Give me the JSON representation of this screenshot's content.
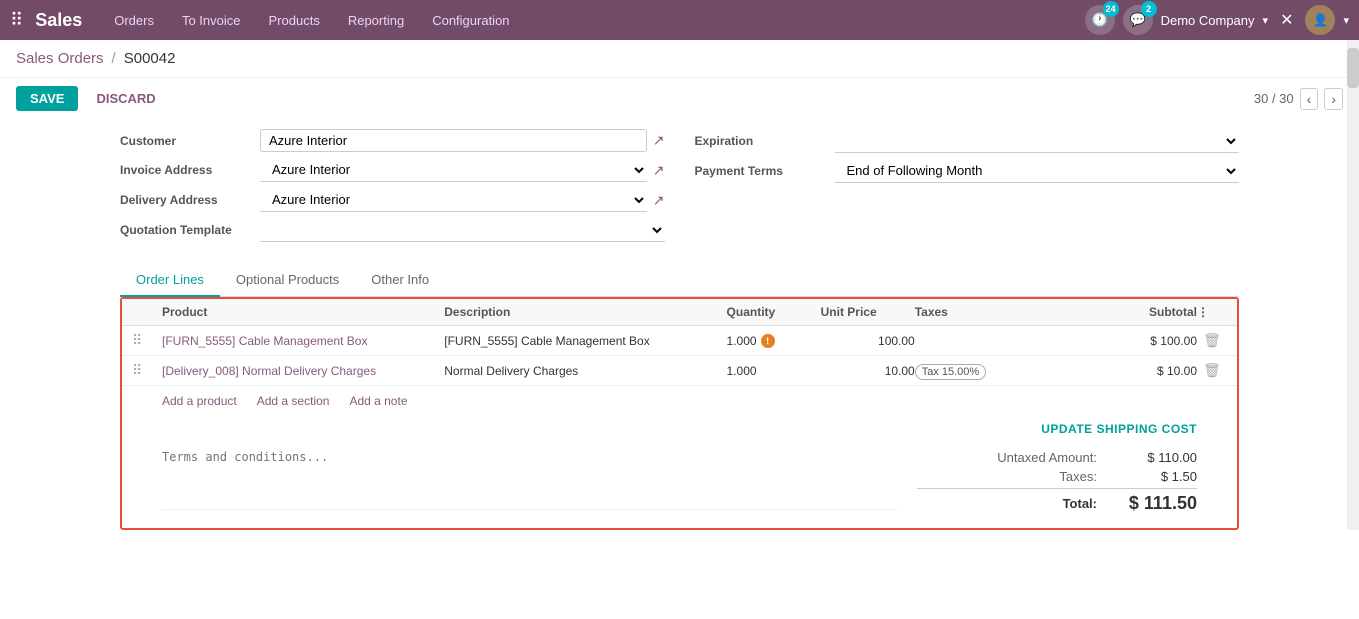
{
  "topnav": {
    "app_name": "Sales",
    "links": [
      "Orders",
      "To Invoice",
      "Products",
      "Reporting",
      "Configuration"
    ],
    "badge_24": "24",
    "badge_2": "2",
    "company": "Demo Company"
  },
  "breadcrumb": {
    "parent": "Sales Orders",
    "separator": "/",
    "current": "S00042"
  },
  "toolbar": {
    "save_label": "SAVE",
    "discard_label": "DISCARD",
    "pagination": "30 / 30"
  },
  "form": {
    "customer_label": "Customer",
    "customer_value": "Azure Interior",
    "invoice_address_label": "Invoice Address",
    "invoice_address_value": "Azure Interior",
    "delivery_address_label": "Delivery Address",
    "delivery_address_value": "Azure Interior",
    "quotation_template_label": "Quotation Template",
    "quotation_template_value": "",
    "expiration_label": "Expiration",
    "expiration_value": "",
    "payment_terms_label": "Payment Terms",
    "payment_terms_value": "End of Following Month"
  },
  "tabs": [
    {
      "label": "Order Lines",
      "active": true
    },
    {
      "label": "Optional Products",
      "active": false
    },
    {
      "label": "Other Info",
      "active": false
    }
  ],
  "table": {
    "headers": [
      "",
      "Product",
      "Description",
      "Quantity",
      "Unit Price",
      "Taxes",
      "Subtotal",
      ""
    ],
    "rows": [
      {
        "product": "[FURN_5555] Cable Management Box",
        "description": "[FURN_5555] Cable Management Box",
        "quantity": "1.000",
        "unit_price": "100.00",
        "taxes": "",
        "subtotal": "$ 100.00",
        "has_info": true
      },
      {
        "product": "[Delivery_008] Normal Delivery Charges",
        "description": "Normal Delivery Charges",
        "quantity": "1.000",
        "unit_price": "10.00",
        "taxes": "Tax 15.00%",
        "subtotal": "$ 10.00",
        "has_info": false
      }
    ],
    "add_product": "Add a product",
    "add_section": "Add a section",
    "add_note": "Add a note"
  },
  "shipping": {
    "update_label": "UPDATE SHIPPING COST"
  },
  "terms": {
    "placeholder": "Terms and conditions..."
  },
  "totals": {
    "untaxed_label": "Untaxed Amount:",
    "untaxed_value": "$ 110.00",
    "taxes_label": "Taxes:",
    "taxes_value": "$ 1.50",
    "total_label": "Total:",
    "total_value": "$ 111.50"
  }
}
